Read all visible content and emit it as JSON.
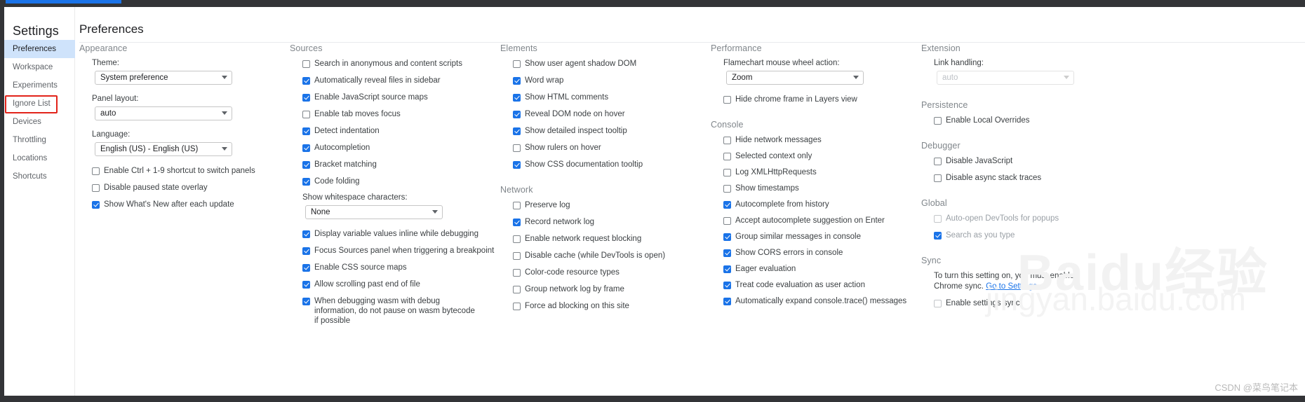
{
  "sidebar": {
    "title": "Settings",
    "items": [
      {
        "label": "Preferences",
        "selected": true,
        "highlighted": false
      },
      {
        "label": "Workspace",
        "selected": false,
        "highlighted": false
      },
      {
        "label": "Experiments",
        "selected": false,
        "highlighted": false
      },
      {
        "label": "Ignore List",
        "selected": false,
        "highlighted": true
      },
      {
        "label": "Devices",
        "selected": false,
        "highlighted": false
      },
      {
        "label": "Throttling",
        "selected": false,
        "highlighted": false
      },
      {
        "label": "Locations",
        "selected": false,
        "highlighted": false
      },
      {
        "label": "Shortcuts",
        "selected": false,
        "highlighted": false
      }
    ],
    "highlight_color": "#e2231a",
    "selected_color": "#cfe3fb"
  },
  "page": {
    "title": "Preferences"
  },
  "columns": [
    {
      "groups": [
        {
          "title": "Appearance",
          "fields": [
            {
              "type": "select",
              "label": "Theme:",
              "value": "System preference",
              "disabled": false
            },
            {
              "type": "select",
              "label": "Panel layout:",
              "value": "auto",
              "disabled": false
            },
            {
              "type": "select",
              "label": "Language:",
              "value": "English (US) - English (US)",
              "disabled": false
            }
          ],
          "checkboxes": [
            {
              "label": "Enable Ctrl + 1-9 shortcut to switch panels",
              "checked": false
            },
            {
              "label": "Disable paused state overlay",
              "checked": false
            },
            {
              "label": "Show What's New after each update",
              "checked": true
            }
          ]
        }
      ]
    },
    {
      "groups": [
        {
          "title": "Sources",
          "checkboxes_top": [
            {
              "label": "Search in anonymous and content scripts",
              "checked": false
            },
            {
              "label": "Automatically reveal files in sidebar",
              "checked": true
            },
            {
              "label": "Enable JavaScript source maps",
              "checked": true
            },
            {
              "label": "Enable tab moves focus",
              "checked": false
            },
            {
              "label": "Detect indentation",
              "checked": true
            },
            {
              "label": "Autocompletion",
              "checked": true
            },
            {
              "label": "Bracket matching",
              "checked": true
            },
            {
              "label": "Code folding",
              "checked": true
            }
          ],
          "fields": [
            {
              "type": "select",
              "label": "Show whitespace characters:",
              "value": "None",
              "disabled": false
            }
          ],
          "checkboxes_bottom": [
            {
              "label": "Display variable values inline while debugging",
              "checked": true
            },
            {
              "label": "Focus Sources panel when triggering a breakpoint",
              "checked": true
            },
            {
              "label": "Enable CSS source maps",
              "checked": true
            },
            {
              "label": "Allow scrolling past end of file",
              "checked": true
            },
            {
              "label": "When debugging wasm with debug information, do not pause on wasm bytecode if possible",
              "checked": true,
              "two_line": true
            }
          ]
        }
      ]
    },
    {
      "groups": [
        {
          "title": "Elements",
          "checkboxes": [
            {
              "label": "Show user agent shadow DOM",
              "checked": false
            },
            {
              "label": "Word wrap",
              "checked": true
            },
            {
              "label": "Show HTML comments",
              "checked": true
            },
            {
              "label": "Reveal DOM node on hover",
              "checked": true
            },
            {
              "label": "Show detailed inspect tooltip",
              "checked": true
            },
            {
              "label": "Show rulers on hover",
              "checked": false
            },
            {
              "label": "Show CSS documentation tooltip",
              "checked": true
            }
          ]
        },
        {
          "title": "Network",
          "checkboxes": [
            {
              "label": "Preserve log",
              "checked": false
            },
            {
              "label": "Record network log",
              "checked": true
            },
            {
              "label": "Enable network request blocking",
              "checked": false
            },
            {
              "label": "Disable cache (while DevTools is open)",
              "checked": false
            },
            {
              "label": "Color-code resource types",
              "checked": false
            },
            {
              "label": "Group network log by frame",
              "checked": false
            },
            {
              "label": "Force ad blocking on this site",
              "checked": false
            }
          ]
        }
      ]
    },
    {
      "groups": [
        {
          "title": "Performance",
          "fields": [
            {
              "type": "select",
              "label": "Flamechart mouse wheel action:",
              "value": "Zoom",
              "disabled": false
            }
          ],
          "checkboxes": [
            {
              "label": "Hide chrome frame in Layers view",
              "checked": false
            }
          ]
        },
        {
          "title": "Console",
          "checkboxes": [
            {
              "label": "Hide network messages",
              "checked": false
            },
            {
              "label": "Selected context only",
              "checked": false
            },
            {
              "label": "Log XMLHttpRequests",
              "checked": false
            },
            {
              "label": "Show timestamps",
              "checked": false
            },
            {
              "label": "Autocomplete from history",
              "checked": true
            },
            {
              "label": "Accept autocomplete suggestion on Enter",
              "checked": false
            },
            {
              "label": "Group similar messages in console",
              "checked": true
            },
            {
              "label": "Show CORS errors in console",
              "checked": true
            },
            {
              "label": "Eager evaluation",
              "checked": true
            },
            {
              "label": "Treat code evaluation as user action",
              "checked": true
            },
            {
              "label": "Automatically expand console.trace() messages",
              "checked": true
            }
          ]
        }
      ]
    },
    {
      "groups": [
        {
          "title": "Extension",
          "fields": [
            {
              "type": "select",
              "label": "Link handling:",
              "value": "auto",
              "disabled": true
            }
          ]
        },
        {
          "title": "Persistence",
          "checkboxes": [
            {
              "label": "Enable Local Overrides",
              "checked": false
            }
          ]
        },
        {
          "title": "Debugger",
          "checkboxes": [
            {
              "label": "Disable JavaScript",
              "checked": false
            },
            {
              "label": "Disable async stack traces",
              "checked": false
            }
          ]
        },
        {
          "title": "Global",
          "checkboxes": [
            {
              "label": "Auto-open DevTools for popups",
              "checked": false
            },
            {
              "label": "Search as you type",
              "checked": true
            }
          ]
        },
        {
          "title": "Sync",
          "note_before_link": "To turn this setting on, you must enable Chrome sync. ",
          "note_link": "Go to Settings",
          "checkboxes": [
            {
              "label": "Enable settings sync",
              "checked": false
            }
          ]
        }
      ]
    }
  ],
  "watermarks": {
    "baidu": "Baidu经验",
    "jingyan": "jingyan.baidu.com",
    "csdn": "CSDN @菜鸟笔记本"
  }
}
